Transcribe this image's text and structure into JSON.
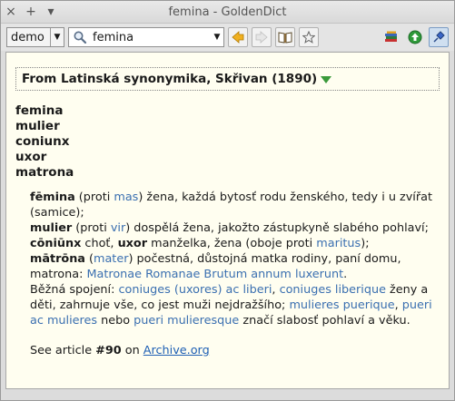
{
  "window": {
    "title": "femina - GoldenDict",
    "btn_close": "×",
    "btn_add": "+",
    "btn_menu": "▾"
  },
  "toolbar": {
    "group": "demo",
    "search_value": "femina",
    "icons": [
      "search-icon",
      "back-icon",
      "forward-icon",
      "dictionary-icon",
      "favorites-star-icon",
      "books-icon",
      "home-icon",
      "pin-icon"
    ]
  },
  "article": {
    "dict_name": "From Latinská synonymika, Skřivan (1890)",
    "headwords": [
      "femina",
      "mulier",
      "coniunx",
      "uxor",
      "matrona"
    ],
    "p1_w": "fēmina",
    "p1_a": " (proti ",
    "p1_l": "mas",
    "p1_b": ") žena, každá bytosť rodu ženského, tedy i u zvířat (samice);",
    "p2_w": "mulier",
    "p2_a": " (proti ",
    "p2_l": "vir",
    "p2_b": ") dospělá žena, jakožto zástupkyně slabého pohlaví;",
    "p3_w": "cōniūnx",
    "p3_a": " choť, ",
    "p3_w2": "uxor",
    "p3_b": " manželka, žena (oboje proti ",
    "p3_l": "maritus",
    "p3_c": ");",
    "p4_w": "mātrōna",
    "p4_a": " (",
    "p4_l": "mater",
    "p4_b": ") počestná, důstojná matka rodiny, paní domu, matrona: ",
    "p4_l2": "Matronae Romanae Brutum annum luxerunt",
    "p4_c": ".",
    "p5_a": "Běžná spojení: ",
    "p5_l1": "coniuges (uxores) ac liberi",
    "p5_sep1": ", ",
    "p5_l2": "coniuges liberique",
    "p5_b": " ženy a děti, zahrnuje vše, co jest muži nejdražšího; ",
    "p5_l3": "mulieres puerique",
    "p5_sep2": ", ",
    "p5_l4": "pueri ac mulieres",
    "p5_c": " nebo ",
    "p5_l5": "pueri mulieresque",
    "p5_d": " značí slabosť pohlaví a věku.",
    "see_a": "See article ",
    "see_num": "#90",
    "see_b": " on ",
    "see_link": "Archive.org"
  }
}
